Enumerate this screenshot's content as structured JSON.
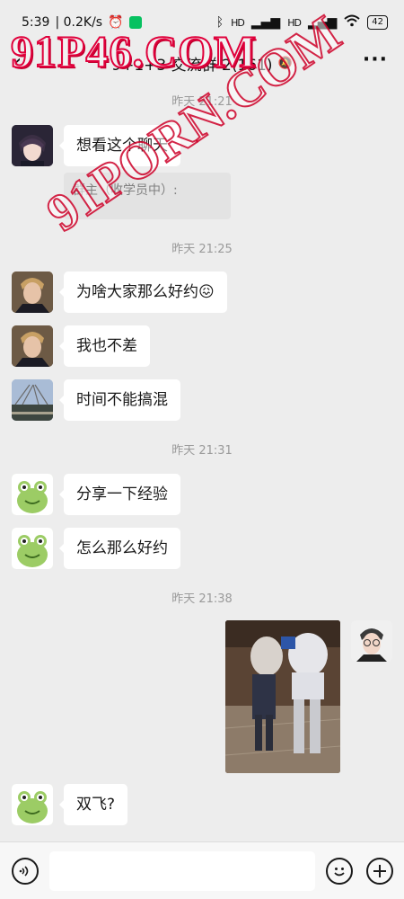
{
  "status_bar": {
    "time": "5:39",
    "speed": "| 0.2K/s",
    "signal": "HD",
    "battery": "42"
  },
  "header": {
    "title": "9+1+3 交流群 2(161)"
  },
  "watermarks": {
    "top": "91P46.COM",
    "diagonal": "91PORN.COM"
  },
  "messages": {
    "ts1": "昨天 21:21",
    "m1": "想看这个聊天",
    "m1_quote": "群主（收学员中）:",
    "ts2": "昨天 21:25",
    "m2": "为啥大家那么好约😖",
    "m3": "我也不差",
    "m4": "时间不能搞混",
    "ts3": "昨天 21:31",
    "m5": "分享一下经验",
    "m6": "怎么那么好约",
    "ts4": "昨天 21:38",
    "m8": "双飞?"
  },
  "icons": {
    "back": "chevron-left-icon",
    "mute": "bell-off-icon",
    "more": "more-icon",
    "voice": "voice-icon",
    "emoji": "emoji-icon",
    "plus": "plus-icon"
  },
  "colors": {
    "background": "#ededed",
    "bubble": "#ffffff",
    "wechat_green": "#07c160",
    "watermark_red": "#e0003b"
  }
}
